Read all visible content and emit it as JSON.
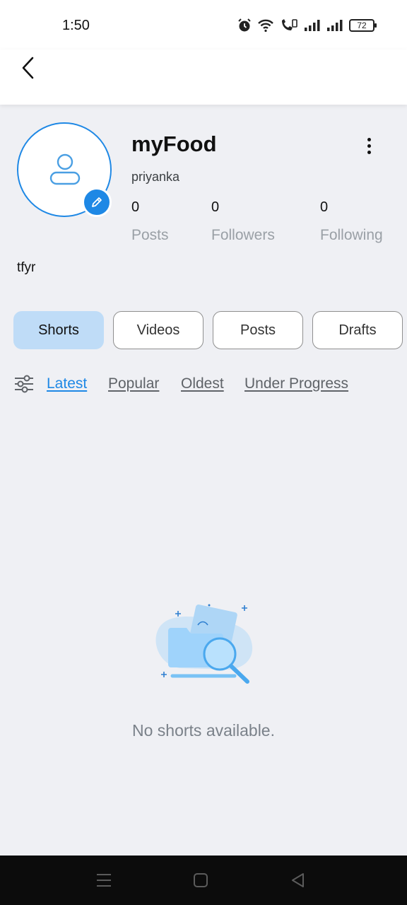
{
  "status_bar": {
    "time": "1:50",
    "battery": "72",
    "icons": [
      "alarm-icon",
      "wifi-icon",
      "volte-call-icon",
      "signal-icon",
      "signal-icon",
      "battery-icon"
    ]
  },
  "app_bar": {
    "back_icon": "chevron-left-icon"
  },
  "profile": {
    "name": "myFood",
    "username": "priyanka",
    "bio": "tfyr",
    "avatar_icon": "person-outline-icon",
    "edit_icon": "pencil-icon",
    "menu_icon": "more-vertical-icon",
    "stats": [
      {
        "count": "0",
        "label": "Posts"
      },
      {
        "count": "0",
        "label": "Followers"
      },
      {
        "count": "0",
        "label": "Following"
      }
    ]
  },
  "tabs": [
    {
      "label": "Shorts",
      "active": true
    },
    {
      "label": "Videos",
      "active": false
    },
    {
      "label": "Posts",
      "active": false
    },
    {
      "label": "Drafts",
      "active": false
    }
  ],
  "filters": {
    "icon": "sliders-icon",
    "items": [
      {
        "label": "Latest",
        "active": true
      },
      {
        "label": "Popular",
        "active": false
      },
      {
        "label": "Oldest",
        "active": false
      },
      {
        "label": "Under Progress",
        "active": false
      }
    ]
  },
  "empty_state": {
    "icon": "empty-folder-search-icon",
    "message": "No shorts available."
  },
  "nav_bar": {
    "items": [
      "menu-icon",
      "home-square-icon",
      "back-triangle-icon"
    ]
  },
  "colors": {
    "accent": "#1e88e5",
    "active_tab_bg": "#bfdcf7",
    "page_bg": "#eff0f4",
    "muted_text": "#9aa0a6"
  }
}
